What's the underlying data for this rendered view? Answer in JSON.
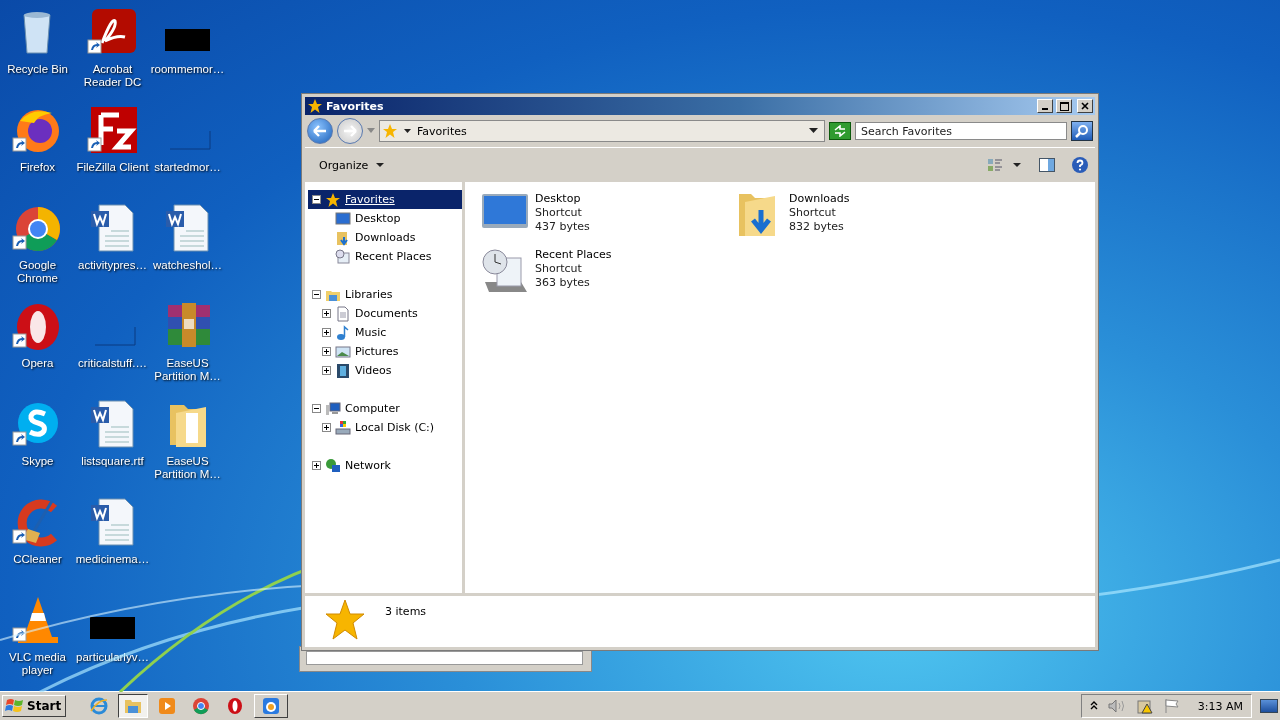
{
  "desktop": {
    "columns": [
      [
        {
          "label": "Recycle Bin",
          "kind": "recycle",
          "shortcut": false
        },
        {
          "label": "Firefox",
          "kind": "firefox",
          "shortcut": true
        },
        {
          "label": "Google Chrome",
          "kind": "chrome",
          "shortcut": true
        },
        {
          "label": "Opera",
          "kind": "opera",
          "shortcut": true
        },
        {
          "label": "Skype",
          "kind": "skype",
          "shortcut": true
        },
        {
          "label": "CCleaner",
          "kind": "ccleaner",
          "shortcut": true
        },
        {
          "label": "VLC media player",
          "kind": "vlc",
          "shortcut": true
        }
      ],
      [
        {
          "label": "Acrobat Reader DC",
          "kind": "pdf",
          "shortcut": true
        },
        {
          "label": "FileZilla Client",
          "kind": "filezilla",
          "shortcut": true
        },
        {
          "label": "activitypres…",
          "kind": "word",
          "shortcut": false
        },
        {
          "label": "criticalstuff.…",
          "kind": "blank",
          "shortcut": false
        },
        {
          "label": "listsquare.rtf",
          "kind": "word",
          "shortcut": false
        },
        {
          "label": "medicinema…",
          "kind": "word",
          "shortcut": false
        },
        {
          "label": "particularlyv…",
          "kind": "black",
          "shortcut": false
        }
      ],
      [
        {
          "label": "roommemor…",
          "kind": "black",
          "shortcut": false
        },
        {
          "label": "startedmor…",
          "kind": "blank",
          "shortcut": false
        },
        {
          "label": "watcheshol…",
          "kind": "word",
          "shortcut": false
        },
        {
          "label": "EaseUS Partition M…",
          "kind": "winrar",
          "shortcut": false
        },
        {
          "label": "EaseUS Partition M…",
          "kind": "folder",
          "shortcut": false
        }
      ]
    ]
  },
  "window": {
    "title": "Favorites",
    "address": {
      "location": "Favorites"
    },
    "search": {
      "placeholder": "Search Favorites"
    },
    "toolbar": {
      "organize": "Organize"
    },
    "nav": [
      {
        "label": "Favorites",
        "kind": "star",
        "expanded": true,
        "selected": true,
        "children": [
          {
            "label": "Desktop",
            "kind": "desktop",
            "selected": false
          },
          {
            "label": "Downloads",
            "kind": "downloads",
            "selected": false
          },
          {
            "label": "Recent Places",
            "kind": "recent",
            "selected": false
          }
        ]
      },
      {
        "label": "Libraries",
        "kind": "library",
        "expanded": true,
        "selected": false,
        "children": [
          {
            "label": "Documents",
            "kind": "documents",
            "expanded": false,
            "selected": false
          },
          {
            "label": "Music",
            "kind": "music",
            "expanded": false,
            "selected": false
          },
          {
            "label": "Pictures",
            "kind": "pictures",
            "expanded": false,
            "selected": false
          },
          {
            "label": "Videos",
            "kind": "videos",
            "expanded": false,
            "selected": false
          }
        ]
      },
      {
        "label": "Computer",
        "kind": "computer",
        "expanded": true,
        "selected": false,
        "children": [
          {
            "label": "Local Disk (C:)",
            "kind": "disk",
            "expanded": false,
            "selected": false
          }
        ]
      },
      {
        "label": "Network",
        "kind": "network",
        "expanded": false,
        "selected": false
      }
    ],
    "files": [
      {
        "name": "Desktop",
        "type": "Shortcut",
        "size": "437 bytes",
        "kind": "desktop"
      },
      {
        "name": "Downloads",
        "type": "Shortcut",
        "size": "832 bytes",
        "kind": "downloads"
      },
      {
        "name": "Recent Places",
        "type": "Shortcut",
        "size": "363 bytes",
        "kind": "recent"
      }
    ],
    "details": {
      "count": "3 items"
    }
  },
  "taskbar": {
    "start": "Start",
    "items": [
      {
        "kind": "ie",
        "active": false
      },
      {
        "kind": "explorer",
        "active": true
      },
      {
        "kind": "media",
        "active": false
      },
      {
        "kind": "chrome",
        "active": false
      },
      {
        "kind": "opera",
        "active": false
      },
      {
        "kind": "task",
        "active": false
      }
    ],
    "tray": {
      "time": "3:13 AM"
    }
  }
}
